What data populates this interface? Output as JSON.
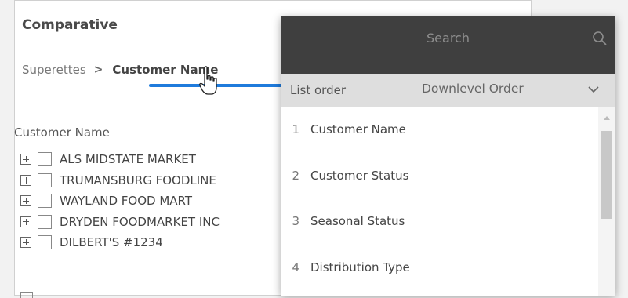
{
  "panel": {
    "title": "Comparative",
    "breadcrumb": {
      "parent": "Superettes",
      "separator": ">",
      "current": "Customer Name"
    },
    "list_header": "Customer Name",
    "rows": [
      "ALS MIDSTATE MARKET",
      "TRUMANSBURG FOODLINE",
      "WAYLAND FOOD MART",
      "DRYDEN FOODMARKET INC",
      "DILBERT'S #1234"
    ]
  },
  "dropdown": {
    "search": {
      "placeholder": "Search"
    },
    "order": {
      "label": "List order",
      "value": "Downlevel Order"
    },
    "items": [
      {
        "num": "1",
        "label": "Customer Name"
      },
      {
        "num": "2",
        "label": "Customer Status"
      },
      {
        "num": "3",
        "label": "Seasonal Status"
      },
      {
        "num": "4",
        "label": "Distribution Type"
      }
    ]
  },
  "colors": {
    "accent": "#1f7bdc",
    "search_bg": "#3f3f3f",
    "order_bg": "#dedede"
  },
  "icons": [
    "search-icon",
    "chevron-down-icon",
    "hand-cursor-icon",
    "expand-plus-icon"
  ]
}
